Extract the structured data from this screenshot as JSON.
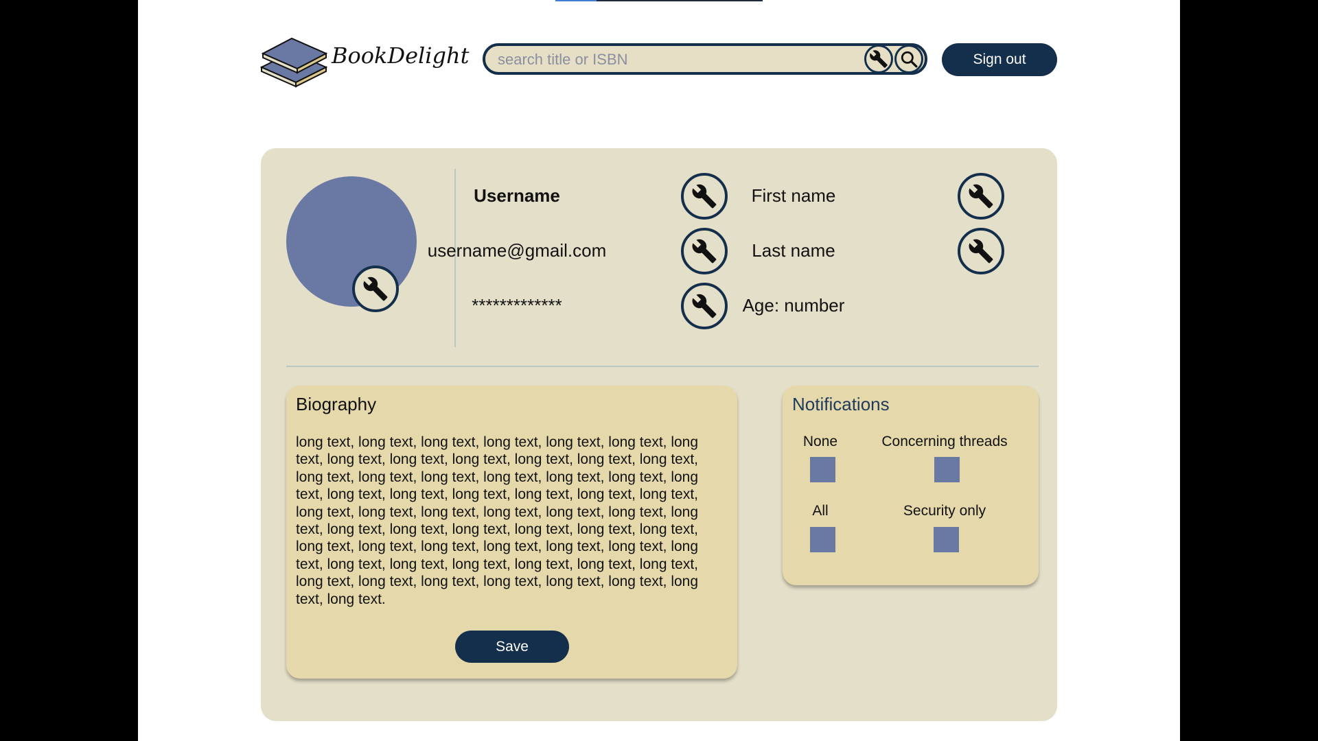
{
  "header": {
    "logo_text": "BookDelight",
    "search_placeholder": "search title or ISBN",
    "signout_label": "Sign out"
  },
  "profile": {
    "username": "Username",
    "email": "username@gmail.com",
    "password_mask": "*************",
    "first_name": "First name",
    "last_name": "Last name",
    "age": "Age: number"
  },
  "biography": {
    "title": "Biography",
    "text": "long text, long text, long text, long text, long text, long text, long text, long text, long text, long text, long text, long text, long text, long text, long text, long text, long text, long text, long text, long text, long text, long text, long text, long text, long text, long text, long text, long text, long text, long text, long text, long text, long text, long text, long text, long text, long text, long text, long text, long text, long text, long text, long text, long text, long text, long text, long text, long text, long text, long text, long text, long text, long text, long text, long text, long text, long text, long text, long text, long text.",
    "save_label": "Save"
  },
  "notifications": {
    "title": "Notifications",
    "options": [
      "None",
      "Concerning threads",
      "All",
      "Security only"
    ]
  },
  "colors": {
    "navy": "#132f4c",
    "card": "#e4dfc8",
    "panel": "#e5d8aa",
    "accent_blue": "#6a79a3"
  },
  "icons": {
    "edit": "wrench-icon",
    "search": "magnifier-icon"
  }
}
